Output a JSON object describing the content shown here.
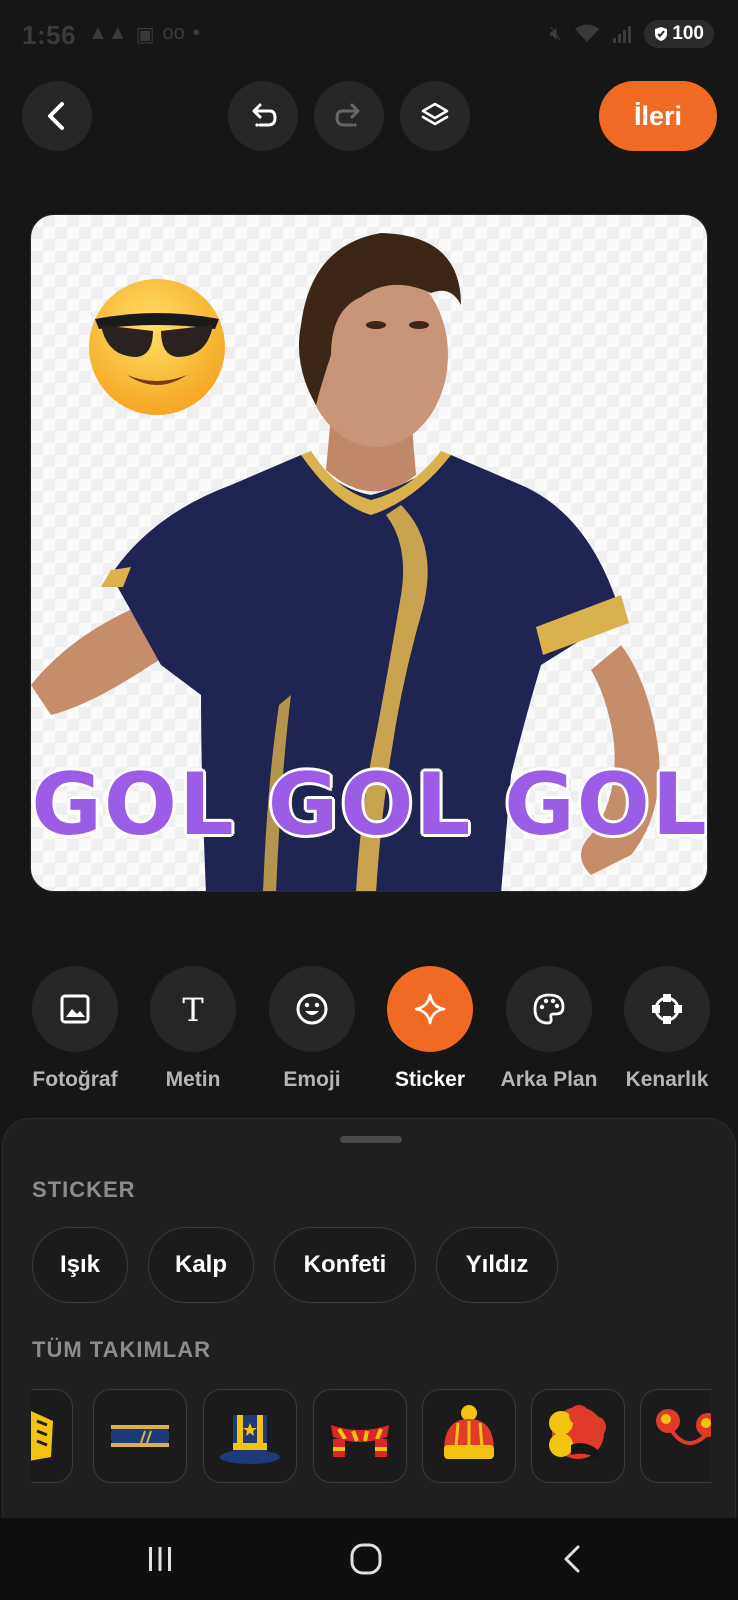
{
  "status_bar": {
    "time": "1:56",
    "battery": "100"
  },
  "header": {
    "next_label": "İleri"
  },
  "canvas": {
    "text_sticker": "GOL GOL GOL"
  },
  "tools": [
    {
      "label": "Fotoğraf",
      "icon": "image-icon",
      "active": false
    },
    {
      "label": "Metin",
      "icon": "text-icon",
      "active": false
    },
    {
      "label": "Emoji",
      "icon": "emoji-icon",
      "active": false
    },
    {
      "label": "Sticker",
      "icon": "sparkle-icon",
      "active": true
    },
    {
      "label": "Arka Plan",
      "icon": "palette-icon",
      "active": false
    },
    {
      "label": "Kenarlık",
      "icon": "border-icon",
      "active": false
    }
  ],
  "sheet": {
    "sticker_title": "STICKER",
    "chips": [
      "Işık",
      "Kalp",
      "Konfeti",
      "Yıldız"
    ],
    "teams_title": "TÜM TAKIMLAR",
    "thumbnails": [
      "glove-sticker",
      "headband-sticker",
      "top-hat-sticker",
      "scarf-sticker",
      "beanie-sticker",
      "afro-wig-sticker",
      "pompom-headband-sticker"
    ]
  },
  "colors": {
    "accent": "#f06a23",
    "background": "#161616",
    "gol_text": "#9b5de5"
  }
}
